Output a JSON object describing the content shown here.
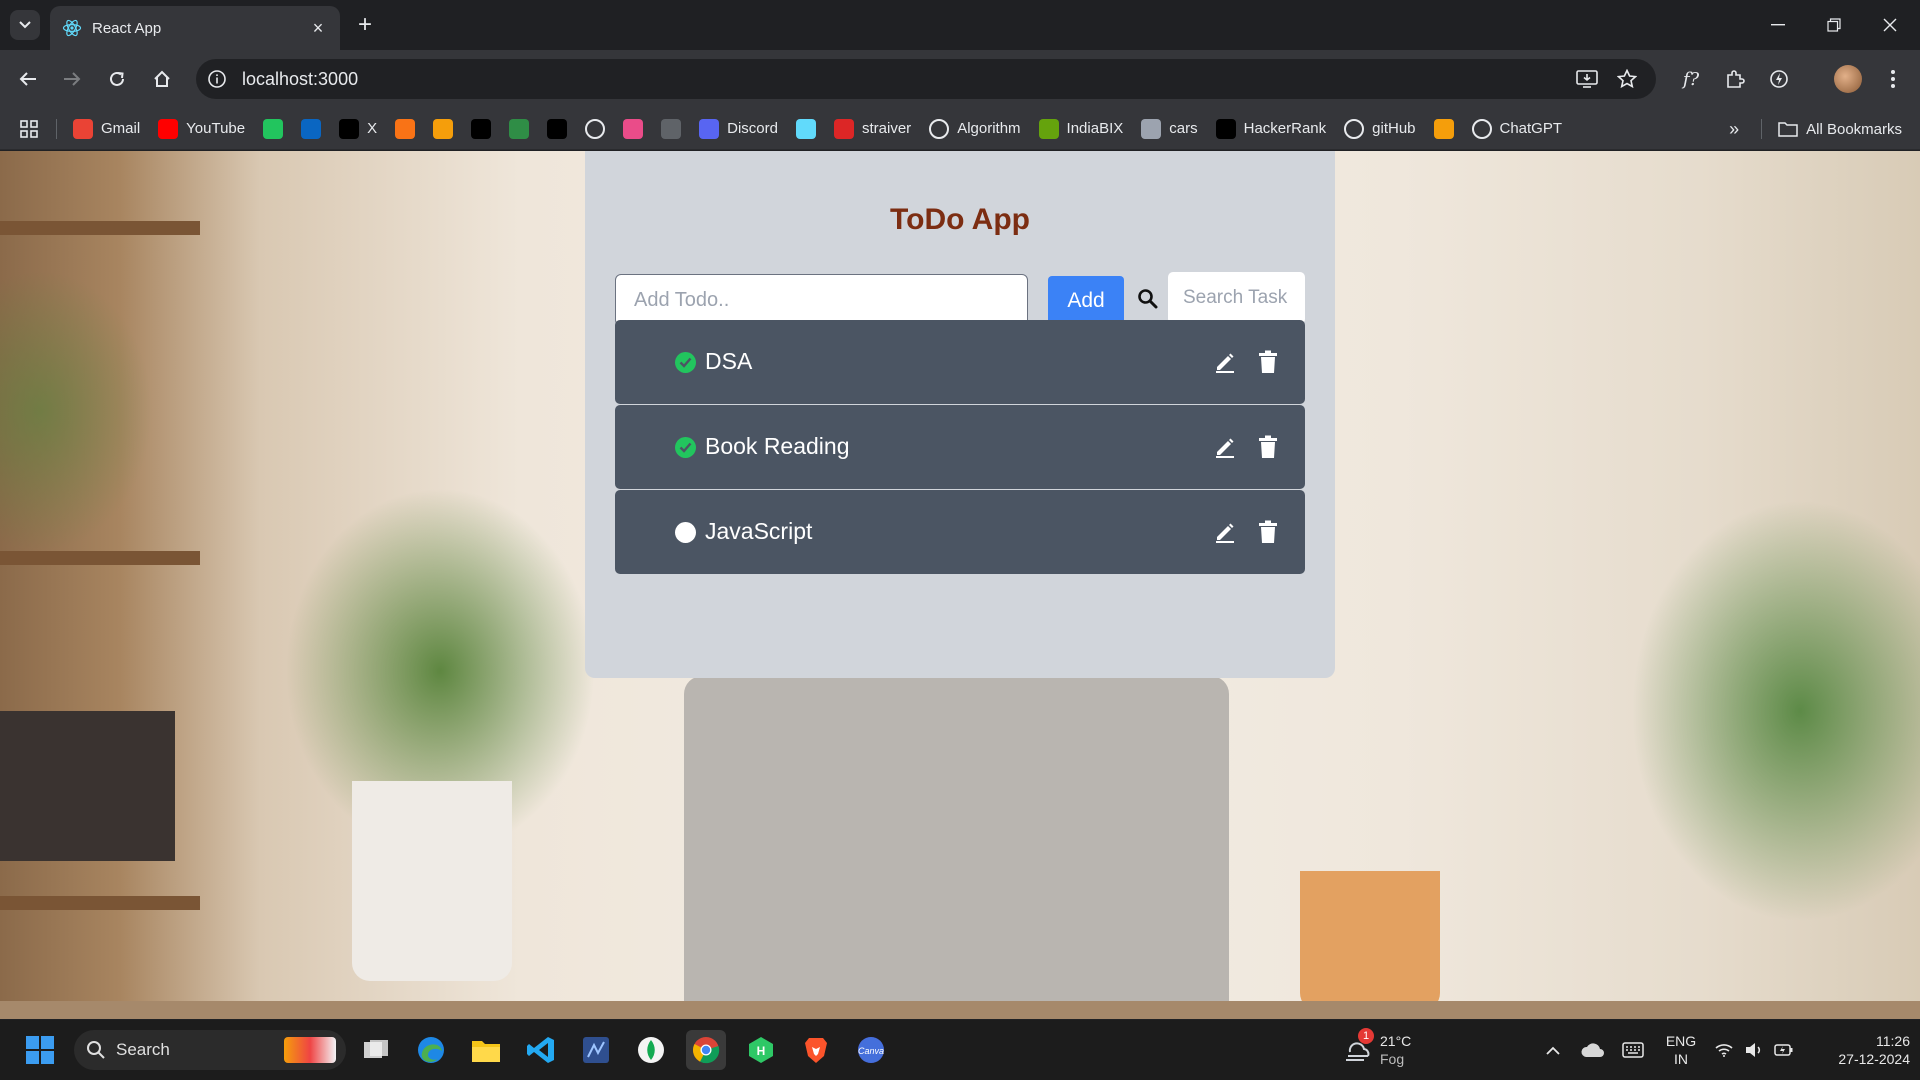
{
  "browser": {
    "tab_title": "React App",
    "url": "localhost:3000",
    "bookmarks": [
      {
        "label": "Gmail",
        "icon": "gmail-icon",
        "color": "#ea4335"
      },
      {
        "label": "YouTube",
        "icon": "youtube-icon",
        "color": "#ff0000"
      },
      {
        "label": "",
        "icon": "wellfound-icon",
        "color": "#22c55e"
      },
      {
        "label": "",
        "icon": "linkedin-icon",
        "color": "#0a66c2"
      },
      {
        "label": "X",
        "icon": "x-icon",
        "color": "#000000"
      },
      {
        "label": "",
        "icon": "bookmark-orange-icon",
        "color": "#f97316"
      },
      {
        "label": "",
        "icon": "bookmark-stack-icon",
        "color": "#f59e0b"
      },
      {
        "label": "",
        "icon": "hackerrank-small-icon",
        "color": "#000000"
      },
      {
        "label": "",
        "icon": "gfg-icon",
        "color": "#2f8d46"
      },
      {
        "label": "",
        "icon": "medium-icon",
        "color": "#000000"
      },
      {
        "label": "",
        "icon": "codechef-icon",
        "color": "#ffffff"
      },
      {
        "label": "",
        "icon": "dribbble-icon",
        "color": "#ea4c89"
      },
      {
        "label": "",
        "icon": "grid-dots-icon",
        "color": "#5f6368"
      },
      {
        "label": "Discord",
        "icon": "discord-icon",
        "color": "#5865f2"
      },
      {
        "label": "",
        "icon": "react-icon",
        "color": "#61dafb"
      },
      {
        "label": "straiver",
        "icon": "tuf-icon",
        "color": "#dc2626"
      },
      {
        "label": "Algorithm",
        "icon": "github-icon",
        "color": "#ffffff"
      },
      {
        "label": "IndiaBIX",
        "icon": "indiabix-icon",
        "color": "#65a30d"
      },
      {
        "label": "cars",
        "icon": "document-icon",
        "color": "#9ca3af"
      },
      {
        "label": "HackerRank",
        "icon": "hackerrank-icon",
        "color": "#000000"
      },
      {
        "label": "gitHub",
        "icon": "github-icon",
        "color": "#ffffff"
      },
      {
        "label": "",
        "icon": "bookmark-stack-icon",
        "color": "#f59e0b"
      },
      {
        "label": "ChatGPT",
        "icon": "chatgpt-icon",
        "color": "#ffffff"
      }
    ],
    "all_bookmarks_label": "All Bookmarks"
  },
  "app": {
    "title": "ToDo App",
    "add_placeholder": "Add Todo..",
    "add_button": "Add",
    "search_placeholder": "Search Task",
    "todos": [
      {
        "text": "DSA",
        "completed": true
      },
      {
        "text": "Book Reading",
        "completed": true
      },
      {
        "text": "JavaScript",
        "completed": false
      }
    ]
  },
  "taskbar": {
    "search_label": "Search",
    "weather_temp": "21°C",
    "weather_desc": "Fog",
    "weather_badge": "1",
    "lang_top": "ENG",
    "lang_bottom": "IN",
    "time": "11:26",
    "date": "27-12-2024"
  }
}
